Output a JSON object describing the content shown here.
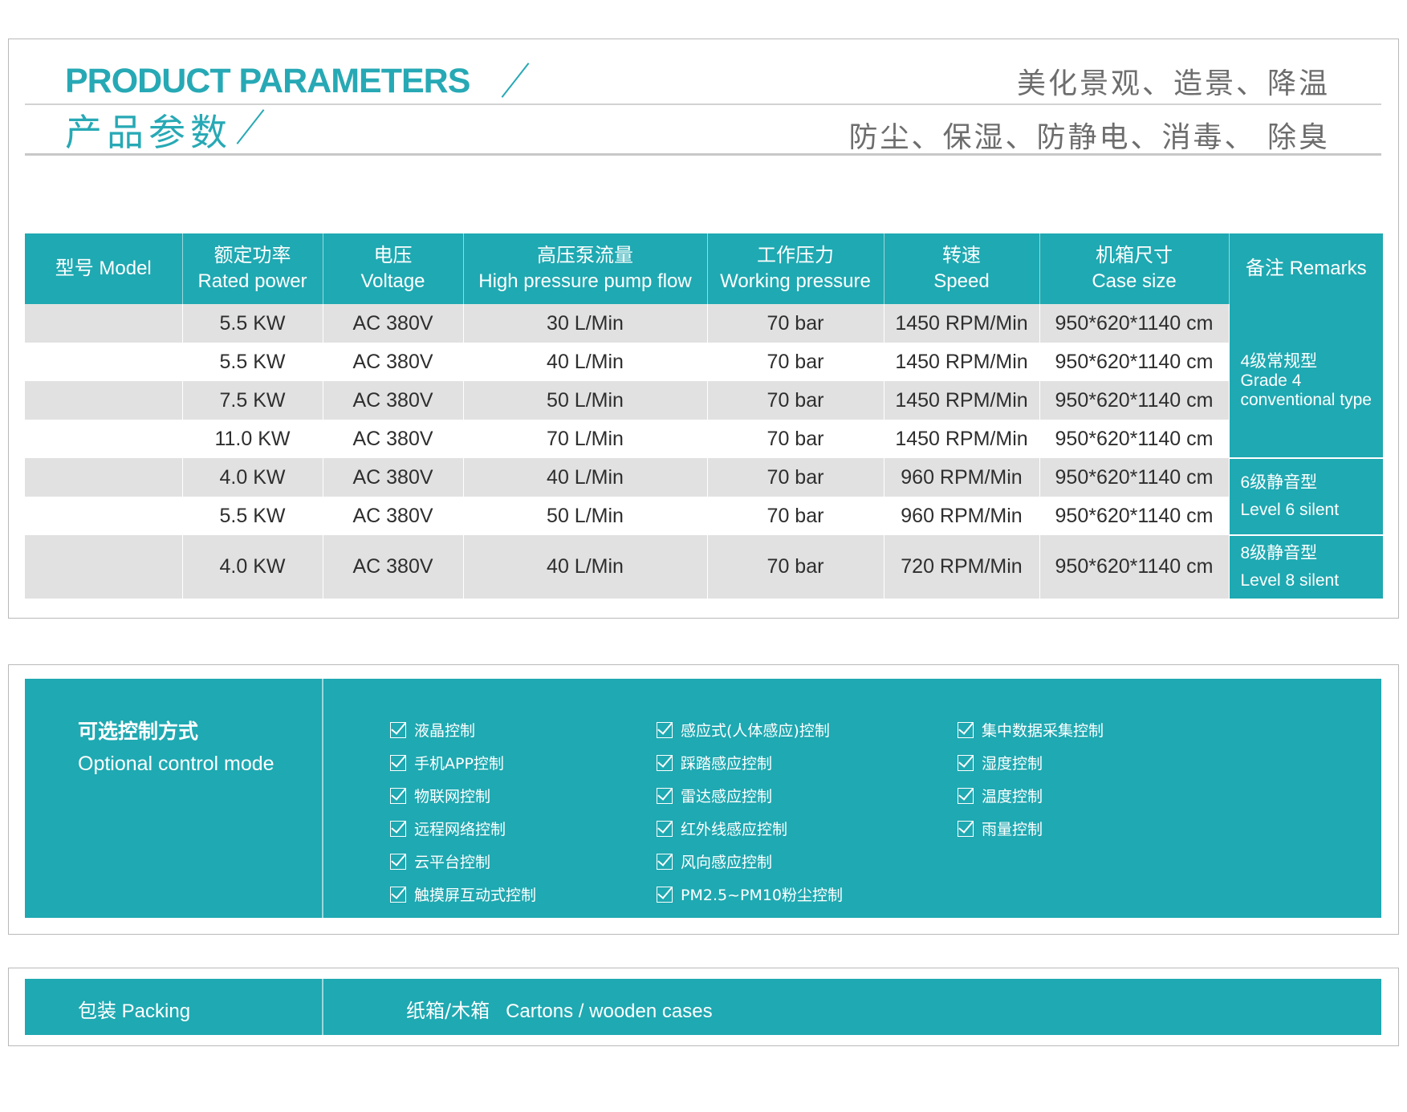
{
  "header": {
    "title_en": "PRODUCT PARAMETERS",
    "title_cn": "产品参数",
    "tagline_1": "美化景观、造景、降温",
    "tagline_2": "防尘、保湿、防静电、消毒、 除臭"
  },
  "table": {
    "headers": [
      {
        "cn": "型号",
        "en": "Model"
      },
      {
        "cn": "额定功率",
        "en": "Rated power"
      },
      {
        "cn": "电压",
        "en": "Voltage"
      },
      {
        "cn": "高压泵流量",
        "en": "High pressure pump flow"
      },
      {
        "cn": "工作压力",
        "en": "Working pressure"
      },
      {
        "cn": "转速",
        "en": "Speed"
      },
      {
        "cn": "机箱尺寸",
        "en": "Case size"
      },
      {
        "cn": "备注",
        "en": "Remarks"
      }
    ],
    "rows": [
      {
        "model": "",
        "power": "5.5 KW",
        "voltage": "AC 380V",
        "flow": "30 L/Min",
        "pressure": "70 bar",
        "speed": "1450 RPM/Min",
        "size": "950*620*1140 cm"
      },
      {
        "model": "",
        "power": "5.5 KW",
        "voltage": "AC 380V",
        "flow": "40 L/Min",
        "pressure": "70 bar",
        "speed": "1450 RPM/Min",
        "size": "950*620*1140 cm"
      },
      {
        "model": "",
        "power": "7.5 KW",
        "voltage": "AC 380V",
        "flow": "50 L/Min",
        "pressure": "70 bar",
        "speed": "1450 RPM/Min",
        "size": "950*620*1140 cm"
      },
      {
        "model": "",
        "power": "11.0 KW",
        "voltage": "AC 380V",
        "flow": "70 L/Min",
        "pressure": "70 bar",
        "speed": "1450 RPM/Min",
        "size": "950*620*1140 cm"
      },
      {
        "model": "",
        "power": "4.0 KW",
        "voltage": "AC 380V",
        "flow": "40 L/Min",
        "pressure": "70 bar",
        "speed": "960 RPM/Min",
        "size": "950*620*1140 cm"
      },
      {
        "model": "",
        "power": "5.5 KW",
        "voltage": "AC 380V",
        "flow": "50 L/Min",
        "pressure": "70 bar",
        "speed": "960 RPM/Min",
        "size": "950*620*1140 cm"
      },
      {
        "model": "",
        "power": "4.0 KW",
        "voltage": "AC 380V",
        "flow": "40 L/Min",
        "pressure": "70 bar",
        "speed": "720 RPM/Min",
        "size": "950*620*1140 cm"
      }
    ],
    "remarks": [
      {
        "cn": "4级常规型",
        "en": "Grade 4 conventional type"
      },
      {
        "cn": "6级静音型",
        "en": "Level 6 silent"
      },
      {
        "cn": "8级静音型",
        "en": "Level 8 silent"
      }
    ]
  },
  "options": {
    "title_cn": "可选控制方式",
    "title_en": "Optional control mode",
    "col1": [
      "液晶控制",
      "手机APP控制",
      "物联网控制",
      "远程网络控制",
      "云平台控制",
      "触摸屏互动式控制"
    ],
    "col2": [
      "感应式(人体感应)控制",
      "踩踏感应控制",
      "雷达感应控制",
      "红外线感应控制",
      "风向感应控制",
      "PM2.5~PM10粉尘控制"
    ],
    "col3": [
      "集中数据采集控制",
      "湿度控制",
      "温度控制",
      "雨量控制"
    ]
  },
  "packing": {
    "label": "包装 Packing",
    "value_cn": "纸箱/木箱",
    "value_en": "Cartons / wooden cases"
  },
  "colors": {
    "accent": "#1fa9b2",
    "title": "#27a9b5",
    "row_gray": "#e1e1e1"
  }
}
